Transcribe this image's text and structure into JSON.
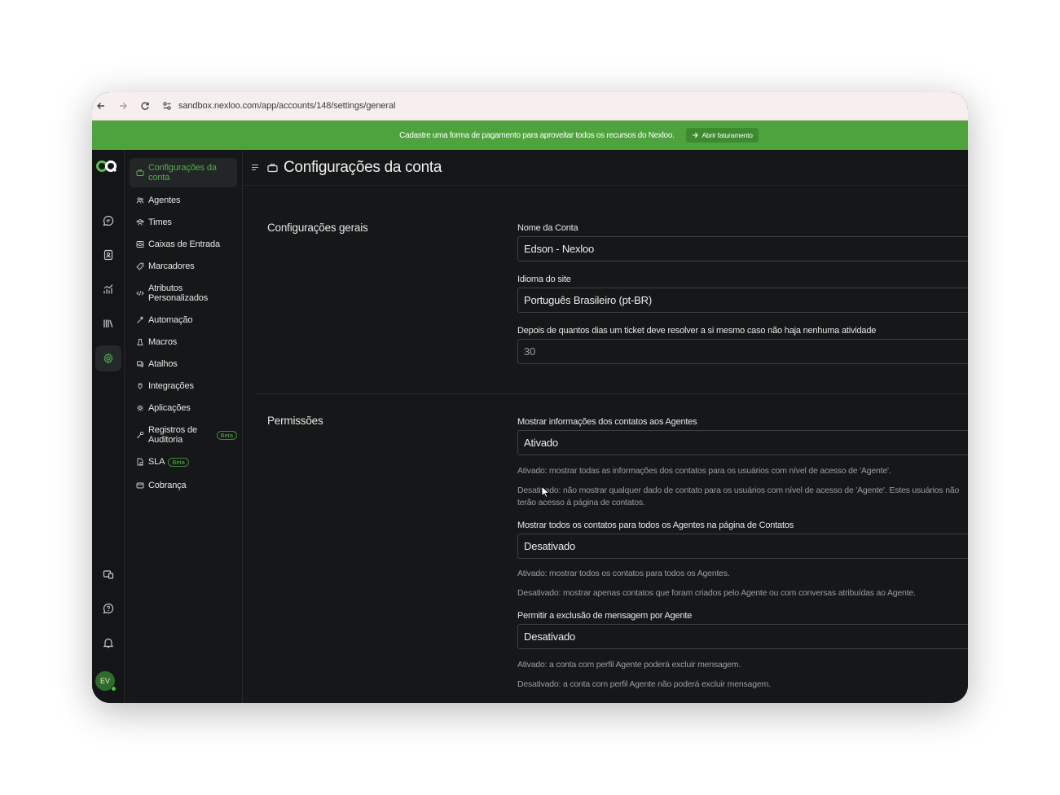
{
  "browser": {
    "url": "sandbox.nexloo.com/app/accounts/148/settings/general"
  },
  "banner": {
    "message": "Cadastre uma forma de pagamento para aproveitar todos os recursos do Nexloo.",
    "button_label": "Abrir faturamento"
  },
  "rail": {
    "icons": [
      "conversations-icon",
      "contacts-icon",
      "reports-icon",
      "library-icon",
      "settings-icon"
    ],
    "bottom_icons": [
      "switch-account-icon",
      "help-icon",
      "notifications-icon"
    ],
    "avatar_initials": "EV"
  },
  "sidebar": {
    "items": [
      {
        "label": "Configurações da conta",
        "icon": "briefcase-icon",
        "active": true
      },
      {
        "label": "Agentes",
        "icon": "people-icon"
      },
      {
        "label": "Times",
        "icon": "team-icon"
      },
      {
        "label": "Caixas de Entrada",
        "icon": "inbox-icon"
      },
      {
        "label": "Marcadores",
        "icon": "tag-icon"
      },
      {
        "label": "Atributos Personalizados",
        "icon": "code-icon"
      },
      {
        "label": "Automação",
        "icon": "automation-icon"
      },
      {
        "label": "Macros",
        "icon": "macro-icon"
      },
      {
        "label": "Atalhos",
        "icon": "chat-shortcut-icon"
      },
      {
        "label": "Integrações",
        "icon": "plug-icon"
      },
      {
        "label": "Aplicações",
        "icon": "apps-icon"
      },
      {
        "label": "Registros de Auditoria",
        "icon": "key-icon",
        "badge": "Beta"
      },
      {
        "label": "SLA",
        "icon": "sla-icon",
        "badge": "Beta"
      },
      {
        "label": "Cobrança",
        "icon": "billing-icon"
      }
    ]
  },
  "header": {
    "title": "Configurações da conta"
  },
  "general": {
    "title": "Configurações gerais",
    "account_name_label": "Nome da Conta",
    "account_name_value": "Edson - Nexloo",
    "language_label": "Idioma do site",
    "language_value": "Português Brasileiro (pt-BR)",
    "auto_resolve_label": "Depois de quantos dias um ticket deve resolver a si mesmo caso não haja nenhuma atividade",
    "auto_resolve_value": "30"
  },
  "permissions": {
    "title": "Permissões",
    "contact_info_label": "Mostrar informações dos contatos aos Agentes",
    "contact_info_value": "Ativado",
    "contact_info_help_on": "Ativado: mostrar todas as informações dos contatos para os usuários com nível de acesso de 'Agente'.",
    "contact_info_help_off": "Desativado: não mostrar qualquer dado de contato para os usuários com nível de acesso de 'Agente'. Estes usuários não terão acesso à página de contatos.",
    "all_contacts_label": "Mostrar todos os contatos para todos os Agentes na página de Contatos",
    "all_contacts_value": "Desativado",
    "all_contacts_help_on": "Ativado: mostrar todos os contatos para todos os Agentes.",
    "all_contacts_help_off": "Desativado: mostrar apenas contatos que foram criados pelo Agente ou com conversas atribuídas ao Agente.",
    "delete_message_label": "Permitir a exclusão de mensagem por Agente",
    "delete_message_value": "Desativado",
    "delete_message_help_on": "Ativado: a conta com perfil Agente poderá excluir mensagem.",
    "delete_message_help_off": "Desativado: a conta com perfil Agente não poderá excluir mensagem."
  },
  "colors": {
    "accent": "#4fb045",
    "banner": "#4ea33e",
    "background": "#161718"
  }
}
